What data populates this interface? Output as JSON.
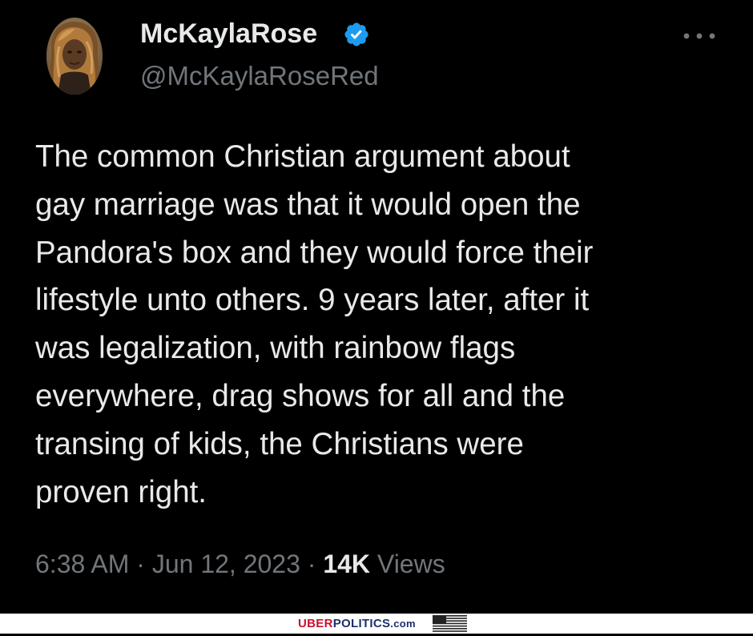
{
  "user": {
    "display_name": "McKaylaRose",
    "handle": "@McKaylaRoseRed",
    "verified": true,
    "avatar": "profile-photo"
  },
  "tweet": {
    "text": "The common Christian argument about\ngay marriage was that it would open the\nPandora's box and they would force their\nlifestyle unto others. 9 years later, after it\nwas legalization, with rainbow flags\neverywhere, drag shows for all and the\ntransing of kids, the Christians were\nproven right.",
    "time": "6:38 AM",
    "separator": "·",
    "date": "Jun 12, 2023",
    "views_count": "14K",
    "views_label": "Views"
  },
  "icons": {
    "more": "more-dots-icon",
    "verified": "verified-badge-icon",
    "flag": "us-flag-icon"
  },
  "footer": {
    "brand_part1": "UBER",
    "brand_part2": "POLITICS",
    "brand_part3": ".com"
  },
  "colors": {
    "background": "#000000",
    "primary_text": "#e7e9ea",
    "secondary_text": "#71767b",
    "verified_blue": "#1d9bf0",
    "brand_red": "#c8102e",
    "brand_blue": "#1c2f6b"
  }
}
